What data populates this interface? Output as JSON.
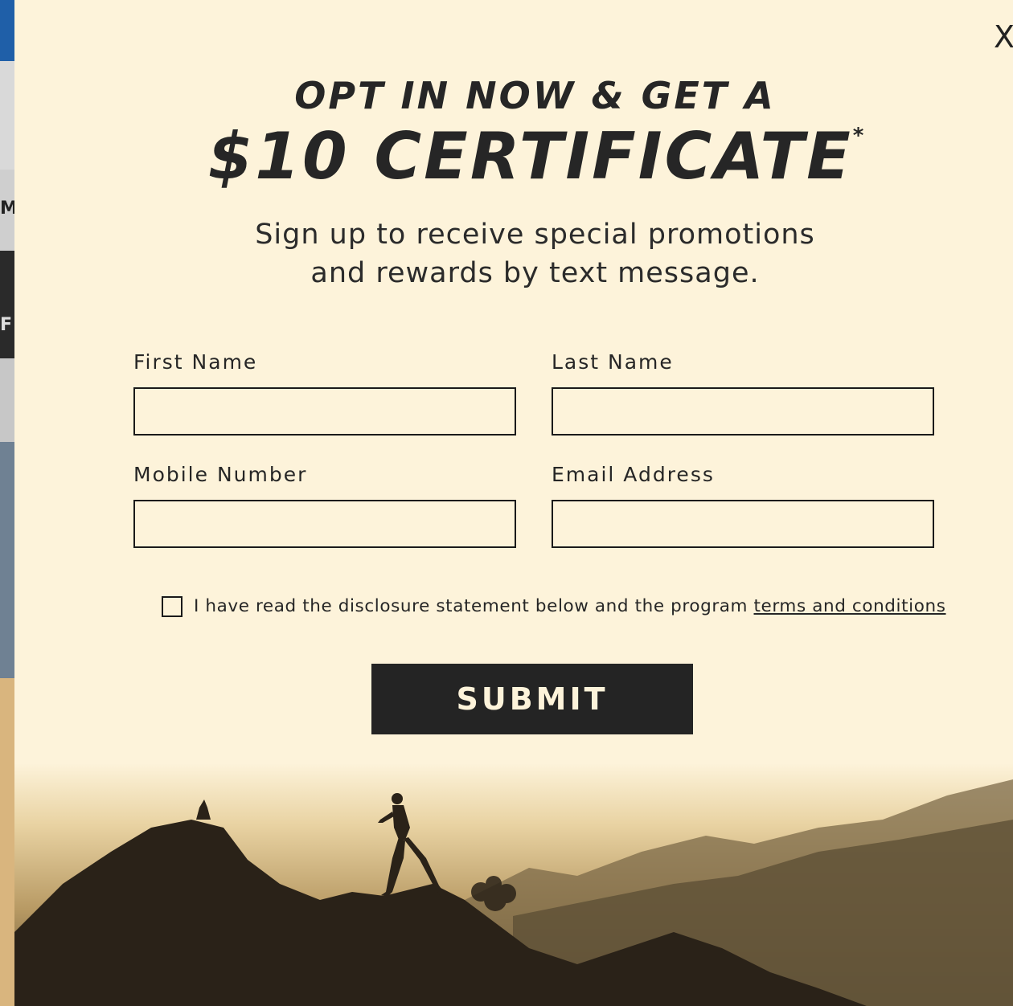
{
  "background_page": {
    "edge_glyph_1": "M",
    "edge_glyph_2": "F"
  },
  "modal": {
    "close_label": "X",
    "headline_line_1": "OPT IN NOW & GET A",
    "headline_line_2": "$10 CERTIFICATE",
    "headline_asterisk": "*",
    "subtitle_line_1": "Sign up to receive special promotions",
    "subtitle_line_2": "and rewards by text message.",
    "fields": {
      "first_name": {
        "label": "First Name",
        "value": "",
        "placeholder": ""
      },
      "last_name": {
        "label": "Last Name",
        "value": "",
        "placeholder": ""
      },
      "mobile_number": {
        "label": "Mobile Number",
        "value": "",
        "placeholder": ""
      },
      "email_address": {
        "label": "Email Address",
        "value": "",
        "placeholder": ""
      }
    },
    "consent": {
      "checked": false,
      "text": "I have read the disclosure statement below and the program ",
      "link_text": "terms and conditions"
    },
    "submit_label": "SUBMIT"
  },
  "colors": {
    "modal_background": "#fdf3da",
    "text_dark": "#262626",
    "button_background": "#242424",
    "button_text": "#fdf3da"
  }
}
